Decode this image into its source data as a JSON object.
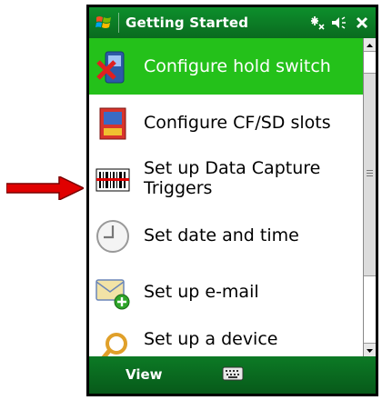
{
  "titlebar": {
    "title": "Getting Started",
    "icons": [
      "windows-start-icon",
      "connectivity-icon",
      "volume-icon",
      "close-icon"
    ]
  },
  "items": [
    {
      "label": "Configure hold switch",
      "icon": "hold-switch-icon",
      "selected": true
    },
    {
      "label": "Configure CF/SD slots",
      "icon": "memory-card-icon",
      "selected": false
    },
    {
      "label": "Set up Data Capture Triggers",
      "icon": "barcode-scanner-icon",
      "selected": false
    },
    {
      "label": "Set date and time",
      "icon": "clock-icon",
      "selected": false
    },
    {
      "label": "Set up e-mail",
      "icon": "email-icon",
      "selected": false
    },
    {
      "label": "Set up a device",
      "icon": "device-setup-icon",
      "selected": false
    }
  ],
  "menubar": {
    "left_softkey": "View",
    "center": "keyboard-icon"
  },
  "colors": {
    "titlebar": "#0a7a22",
    "selection": "#24c11a",
    "arrow": "#e00000"
  }
}
